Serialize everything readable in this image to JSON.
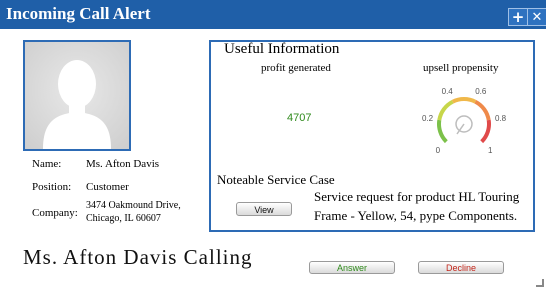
{
  "window": {
    "title": "Incoming Call Alert",
    "plus_glyph": "+",
    "close_glyph": "✕"
  },
  "caller": {
    "fields": [
      {
        "label": "Name:",
        "value": "Ms. Afton Davis"
      },
      {
        "label": "Position:",
        "value": "Customer"
      },
      {
        "label": "Company:",
        "value_lines": [
          "3474 Oakmound Drive,",
          "Chicago, IL 60607"
        ]
      }
    ],
    "calling_text": "Ms. Afton Davis Calling"
  },
  "useful_info": {
    "title": "Useful Information",
    "profit_label": "profit generated",
    "profit_value": "4707",
    "upsell_label": "upsell propensity",
    "gauge": {
      "ticks": [
        "0",
        "0.2",
        "0.4",
        "0.6",
        "0.8",
        "1"
      ],
      "segments": [
        {
          "from": 0,
          "to": 0.2,
          "color": "#7cc14a"
        },
        {
          "from": 0.2,
          "to": 0.4,
          "color": "#c7d64a"
        },
        {
          "from": 0.4,
          "to": 0.6,
          "color": "#f0b84a"
        },
        {
          "from": 0.6,
          "to": 0.8,
          "color": "#ef8a4a"
        },
        {
          "from": 0.8,
          "to": 1.0,
          "color": "#e04a4a"
        }
      ]
    }
  },
  "service_case": {
    "title": "Noteable Service Case",
    "view_label": "View",
    "lines": [
      "Service request for product HL Touring",
      "Frame - Yellow, 54, pype Components."
    ]
  },
  "actions": {
    "answer_label": "Answer",
    "decline_label": "Decline"
  }
}
